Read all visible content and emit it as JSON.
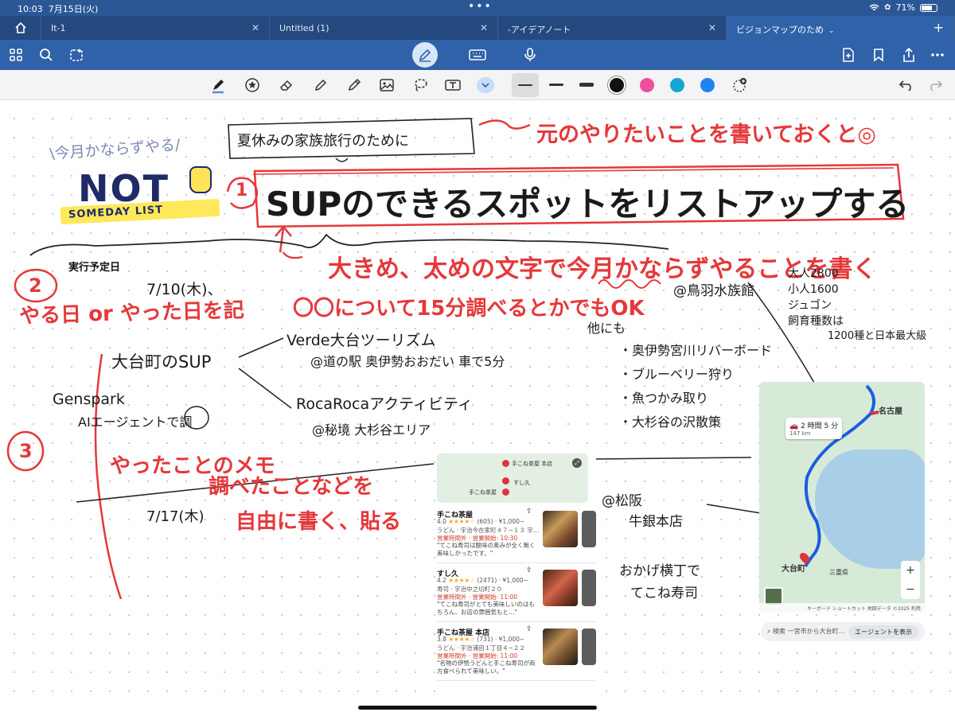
{
  "status": {
    "time": "10:03",
    "date": "7月15日(火)",
    "battery": "71%"
  },
  "tabs": [
    {
      "label": "It-1"
    },
    {
      "label": "Untitled (1)"
    },
    {
      "label": "-アイデアノート"
    },
    {
      "label": "ビジョンマップのため"
    }
  ],
  "colors": {
    "tabbar": "#23497f",
    "toolbar": "#2f62a8",
    "ink_red": "#e5383b",
    "swatch_pink": "#ee4f9c",
    "swatch_cyan": "#16a6d4",
    "swatch_blue": "#1f84f0"
  },
  "toolbar_icons": [
    "grid-icon",
    "search-icon",
    "magic-icon",
    "pen-mode-icon",
    "keyboard-icon",
    "mic-icon",
    "add-page-icon",
    "bookmark-icon",
    "share-icon",
    "more-icon"
  ],
  "tools": [
    "pen-tool",
    "highlighter-shape-tool",
    "eraser-tool",
    "highlighter-tool",
    "pencil-tool",
    "image-tool",
    "lasso-tool",
    "text-tool"
  ],
  "note": {
    "badge": "\\今月かならずやる/",
    "logo_not": "NOT",
    "logo_list": "SOMEDAY LIST",
    "box_small": "夏休みの家族旅行のために",
    "arrow_note": "元のやりたいことを書いておくと◎",
    "num1": "1",
    "title": "SUPのできるスポットをリストアップする",
    "sub_note": "大きめ、太めの文字で今月かならずやることを書く",
    "num2": "2",
    "date_label": "実行予定日",
    "date_value": "7/10(木)、",
    "date_note1": "やる日 or やった日を記",
    "date_note2": "〇〇について15分調べるとかでもOK",
    "aquarium": "@鳥羽水族館",
    "price1": "大人2800",
    "price2": "小人1600",
    "dugong": "ジュゴン",
    "species1": "飼育種数は",
    "species2": "1200種と日本最大級",
    "others": "他にも",
    "other1": "・奥伊勢宮川リバーボード",
    "other2": "・ブルーベリー狩り",
    "other3": "・魚つかみ取り",
    "other4": "・大杉谷の沢散策",
    "sup_head": "大台町のSUP",
    "verde": "Verde大台ツーリズム",
    "verde_at": "@道の駅 奥伊勢おおだい 車で5分",
    "rocaroca": "RocaRocaアクティビティ",
    "rocaroca_at": "@秘境 大杉谷エリア",
    "genspark1": "Genspark",
    "genspark2": "AIエージェントで調",
    "num3": "3",
    "memo1": "やったことのメモ",
    "memo2": "調べたことなどを",
    "memo3": "自由に書く、貼る",
    "date2": "7/17(木)",
    "matsusaka1": "@松阪",
    "matsusaka2": "牛銀本店",
    "okage1": "おかげ横丁で",
    "okage2": "てこね寿司"
  },
  "map": {
    "route_time": "2 時間 5 分",
    "route_dist": "147 km",
    "place_nagoya": "名古屋",
    "place_odai": "大台町",
    "place_mie": "三重県",
    "footer": "キーボード ショートカット 地図データ ©2025 利用規約",
    "zoom_in": "+",
    "zoom_out": "−",
    "search_text": "検索 一宮市から大台町…",
    "agent_button": "エージェントを表示"
  },
  "restaurants": {
    "mini_labels": [
      "手こね茶屋 本店",
      "すし久",
      "手こね茶屋"
    ],
    "items": [
      {
        "name": "手こね茶屋",
        "rating": "4.0",
        "stars": "★★★★☆",
        "count": "(605) · ¥1,000~",
        "addr": "うどん · 宇治今在家町４７−１３ 宇…",
        "hours": "営業時間外 · 営業開始: 10:30",
        "review": "\"てこね寿司は酸味の奥みが全く無く美味しかったです。\""
      },
      {
        "name": "すし久",
        "rating": "4.2",
        "stars": "★★★★☆",
        "count": "(2471) · ¥1,000~",
        "addr": "寿司 · 宇治中之切町２０",
        "hours": "営業時間外 · 営業開始: 11:00",
        "review": "\"てこね寿司がとても美味しいのはもちろん、お店の雰囲気もと…\""
      },
      {
        "name": "手こね茶屋 本店",
        "rating": "3.8",
        "stars": "★★★★☆",
        "count": "(731) · ¥1,000~",
        "addr": "うどん · 宇治浦田１丁目４−２２",
        "hours": "営業時間外 · 営業開始: 11:00",
        "review": "\"名物の伊勢うどんと手こね寿司が両方食べられて美味しい。\""
      }
    ]
  }
}
